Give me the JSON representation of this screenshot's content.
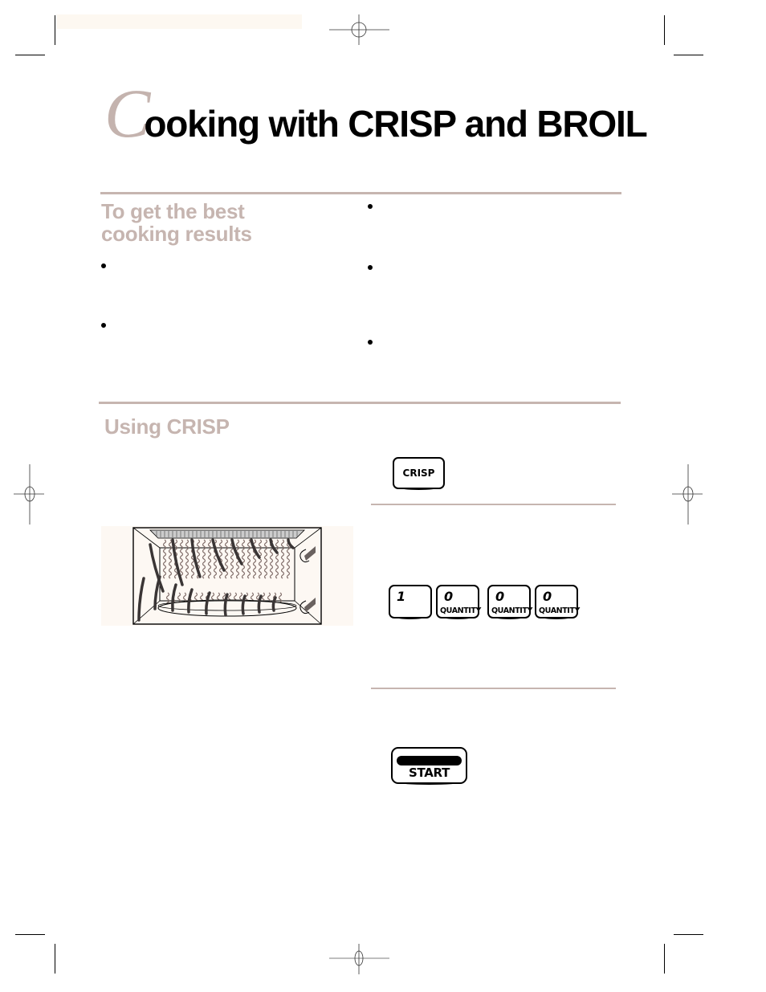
{
  "page": {
    "title_drop_cap": "C",
    "title_rest": "ooking with CRISP and BROIL",
    "accent_color": "#c6b5b0"
  },
  "best_results": {
    "heading_line1": "To get the best",
    "heading_line2": "cooking results",
    "left_bullets": [
      "",
      ""
    ],
    "right_bullets": [
      "",
      "",
      ""
    ]
  },
  "using_crisp": {
    "heading": "Using CRISP",
    "illustration": "broiler-oven-rack-illustration",
    "steps": [
      {
        "keys": [
          {
            "label": "CRISP"
          }
        ]
      },
      {
        "keys": [
          {
            "digit": "1",
            "sub": ""
          },
          {
            "digit": "0",
            "sub": "QUANTITY"
          },
          {
            "digit": "0",
            "sub": "QUANTITY"
          },
          {
            "digit": "0",
            "sub": "QUANTITY"
          }
        ]
      },
      {
        "keys": [
          {
            "label": "START"
          }
        ]
      }
    ]
  }
}
